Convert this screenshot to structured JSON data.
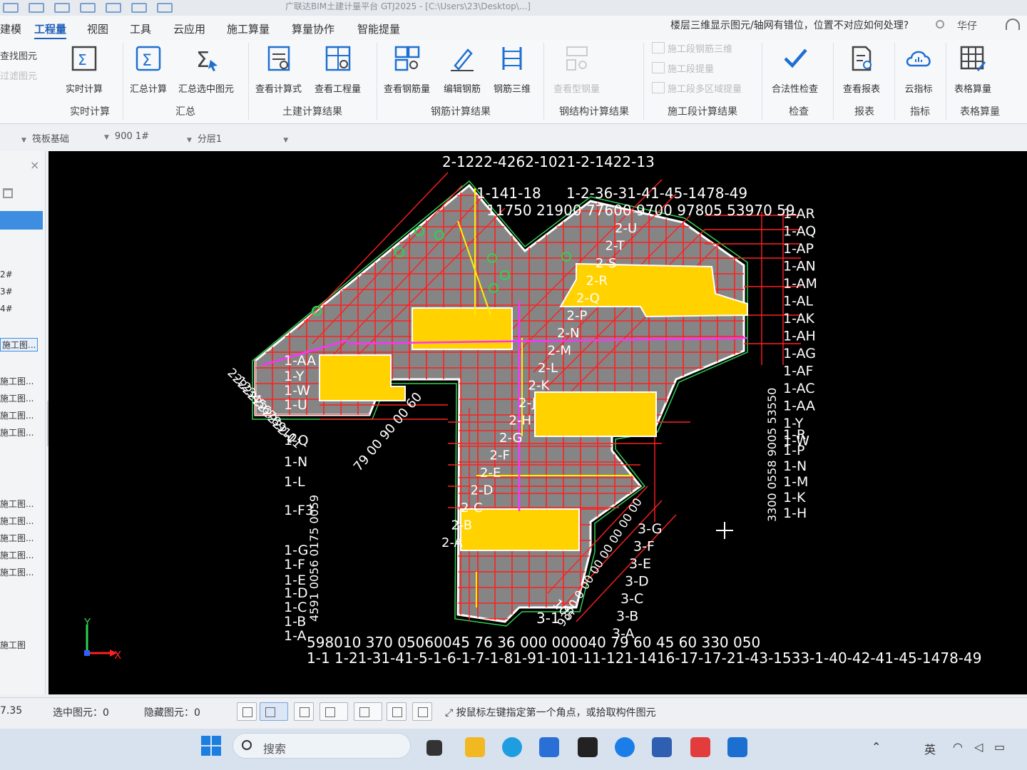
{
  "titlebar": {
    "title": "广联达BIM土建计量平台 GTJ2025 - [C:\\Users\\23\\Desktop\\...]"
  },
  "menu": {
    "items": [
      "建模",
      "工程量",
      "视图",
      "工具",
      "云应用",
      "施工算量",
      "算量协作",
      "智能提量"
    ],
    "help_search": "楼层三维显示图元/轴网有错位，位置不对应如何处理?",
    "user": "华仔"
  },
  "ribbon": {
    "left_mini": [
      "查找图元",
      "过滤图元"
    ],
    "buttons": {
      "realtime_calc": "实时计算",
      "sum_calc": "汇总计算",
      "sum_selected": "汇总选中图元",
      "view_formula": "查看计算式",
      "view_quantity": "查看工程量",
      "view_rebar": "查看钢筋量",
      "edit_rebar": "编辑钢筋",
      "rebar_3d": "钢筋三维",
      "view_steel": "查看型钢量",
      "stage_rebar_3d": "施工段钢筋三维",
      "stage_quantity": "施工段提量",
      "stage_multi": "施工段多区域提量",
      "validity_check": "合法性检查",
      "view_report": "查看报表",
      "cloud_index": "云指标",
      "table_calc": "表格算量"
    },
    "groups": {
      "realtime": "实时计算",
      "summary": "汇总",
      "civil_result": "土建计算结果",
      "rebar_result": "钢筋计算结果",
      "steel_result": "钢结构计算结果",
      "stage_result": "施工段计算结果",
      "check": "检查",
      "report": "报表",
      "index": "指标",
      "table": "表格算量"
    }
  },
  "filters": {
    "component": "筏板基础",
    "floor_name": "900 1#",
    "layer": "分层1"
  },
  "left_panel": {
    "items": [
      "2#",
      "3#",
      "4#"
    ],
    "selected_item": "施工图...",
    "stage_items": [
      "施工图...",
      "施工图...",
      "施工图...",
      "施工图...",
      "施工图...",
      "施工图...",
      "施工图...",
      "施工图...",
      "施工图...",
      "施工图"
    ]
  },
  "canvas": {
    "axis_top": "2-1222-4262-1021-2-1422-13",
    "axis_top2": "1-141-18",
    "axis_top3": "1-2-36-31-41-45-1478-49",
    "dims_top": "11750 21900 77600 9700 97805 53970 59",
    "axis_bottom": "1-1 1-21-31-41-5-1-6-1-7-1-81-91-101-11-121-1416-17-17-21-43-1533-1-40-42-41-45-1478-49",
    "dims_bottom": "598010 370 05060045 76  36 000 000040 79 60 45 60 330 050",
    "right_labels": [
      "1-AR",
      "1-AQ",
      "1-AP",
      "1-AN",
      "1-AM",
      "1-AL",
      "1-AK",
      "1-AH",
      "1-AG",
      "1-AF",
      "1-AC",
      "1-AA",
      "1-Y",
      "1-W",
      "1-R",
      "1-P",
      "1-N",
      "1-M",
      "1-K",
      "1-H"
    ],
    "left_labels": [
      "1-AA",
      "1-Y",
      "1-W",
      "1-U",
      "1-Q",
      "1-N",
      "1-L",
      "1-F3",
      "1-G",
      "1-F",
      "1-E",
      "1-D",
      "1-C",
      "1-B",
      "1-A"
    ],
    "diag_labels": [
      "2-U",
      "2-T",
      "2-S",
      "2-R",
      "2-Q",
      "2-P",
      "2-N",
      "2-M",
      "2-L",
      "2-K",
      "2-J",
      "2-H",
      "2-G",
      "2-F",
      "2-E",
      "2-D",
      "2-C",
      "2-B",
      "2-A"
    ],
    "diag_left_labels": [
      "2-1",
      "2-2",
      "2-3",
      "2-4",
      "2-5",
      "2-6",
      "2-7",
      "2-8",
      "2-9",
      "2-10",
      "2-11"
    ],
    "right_dims": "3300 0558 9005 53550",
    "left_dims": "4591 0056 0175 0059",
    "diag_dims": "79 00 90 00 60",
    "sec3_labels": [
      "3-G",
      "3-F",
      "3-E",
      "3-D",
      "3-C",
      "3-B",
      "3-A"
    ],
    "sec3_num": "3-1",
    "sec3_105": "105",
    "sec3_dims": "9350 0 00 00 00 00 00 00",
    "axis_x": "X",
    "axis_y": "Y"
  },
  "status": {
    "coord": "7.35",
    "selected": "选中图元：0",
    "hidden": "隐藏图元：0",
    "hint": "按鼠标左键指定第一个角点，或拾取构件图元"
  },
  "taskbar": {
    "search": "搜索",
    "lang": "英"
  },
  "colors": {
    "canvas_bg": "#000000",
    "slab": "#808080",
    "grid_red": "#ff1a1a",
    "yellow_fill": "#ffd200",
    "label_white": "#ffffff",
    "accent_blue": "#1f5fb8"
  }
}
